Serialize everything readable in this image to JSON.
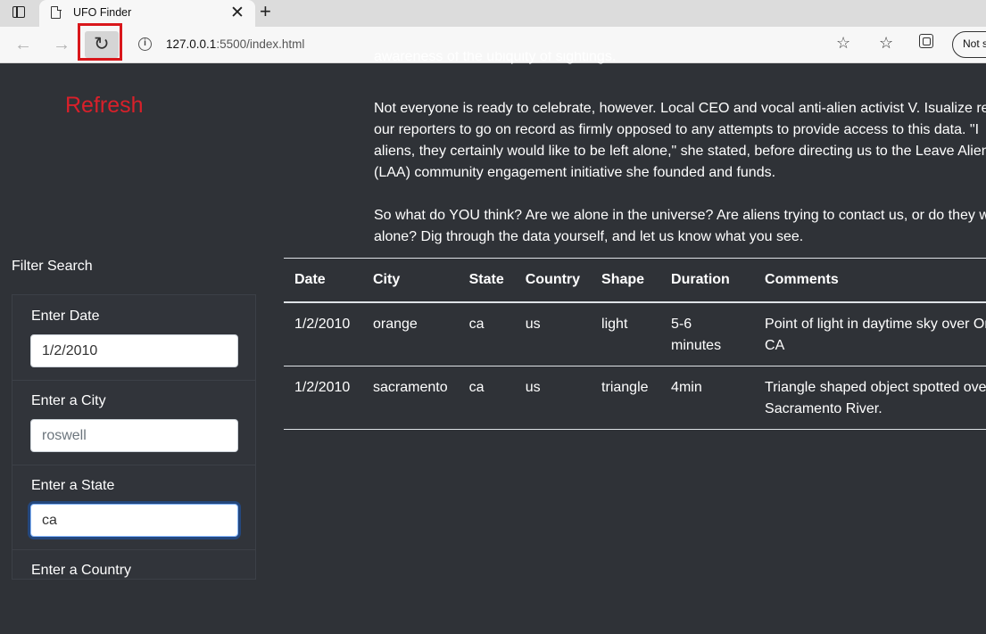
{
  "browser": {
    "tab_title": "UFO Finder",
    "url_host": "127.0.0.1",
    "url_rest": ":5500/index.html",
    "signin_label": "Not s"
  },
  "annotation": {
    "label": "Refresh",
    "color": "#d9202a"
  },
  "article": {
    "top_fragment": "awareness of the ubiquity of sightings.",
    "para2": [
      "Not everyone is ready to celebrate, however. Local CEO and vocal anti-alien activist V. Isualize rea",
      "our reporters to go on record as firmly opposed to any attempts to provide access to this data. \"I",
      "aliens, they certainly would like to be left alone,\" she stated, before directing us to the Leave Alien",
      "(LAA) community engagement initiative she founded and funds."
    ],
    "para3": [
      "So what do YOU think? Are we alone in the universe? Are aliens trying to contact us, or do they w",
      "alone? Dig through the data yourself, and let us know what you see."
    ]
  },
  "filter": {
    "heading": "Filter Search",
    "fields": [
      {
        "label": "Enter Date",
        "value": "1/2/2010",
        "placeholder": ""
      },
      {
        "label": "Enter a City",
        "value": "",
        "placeholder": "roswell"
      },
      {
        "label": "Enter a State",
        "value": "ca",
        "placeholder": ""
      },
      {
        "label": "Enter a Country",
        "value": "",
        "placeholder": ""
      }
    ]
  },
  "table": {
    "headers": [
      "Date",
      "City",
      "State",
      "Country",
      "Shape",
      "Duration",
      "Comments"
    ],
    "rows": [
      [
        "1/2/2010",
        "orange",
        "ca",
        "us",
        "light",
        "5-6 minutes",
        "Point of light in daytime sky over Or CA"
      ],
      [
        "1/2/2010",
        "sacramento",
        "ca",
        "us",
        "triangle",
        "4min",
        "Triangle shaped object spotted over Sacramento River."
      ]
    ]
  },
  "icons": [
    "window-icon",
    "page-icon",
    "close-icon",
    "plus-icon",
    "back-icon",
    "forward-icon",
    "reload-icon",
    "info-icon",
    "add-favorite-icon",
    "favorites-icon",
    "collections-icon"
  ]
}
